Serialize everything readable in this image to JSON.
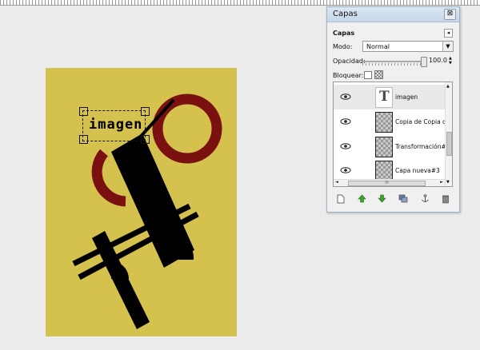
{
  "dialog": {
    "title": "Capas",
    "close_glyph": "⊠",
    "section": "Capas",
    "menu_glyph": "◂",
    "mode_label": "Modo:",
    "mode_value": "Normal",
    "opacity_label": "Opacidad:",
    "opacity_value": "100.0",
    "opacity_fraction": 1.0,
    "lock_label": "Bloquear:",
    "layers": [
      {
        "name": "imagen",
        "type": "text",
        "selected": true
      },
      {
        "name": "Copia de Copia de",
        "type": "raster"
      },
      {
        "name": "Transformación#1",
        "type": "raster"
      },
      {
        "name": "Capa nueva#3",
        "type": "raster"
      }
    ],
    "hscroll_label": "III",
    "bottom_icons": [
      "new-layer-icon",
      "raise-layer-icon",
      "lower-layer-icon",
      "duplicate-layer-icon",
      "anchor-layer-icon",
      "delete-layer-icon"
    ]
  },
  "canvas": {
    "text_layer": "imagen",
    "colors": {
      "background": "#d4c14e",
      "ring": "#7a1010",
      "shapes": "#000000"
    }
  }
}
